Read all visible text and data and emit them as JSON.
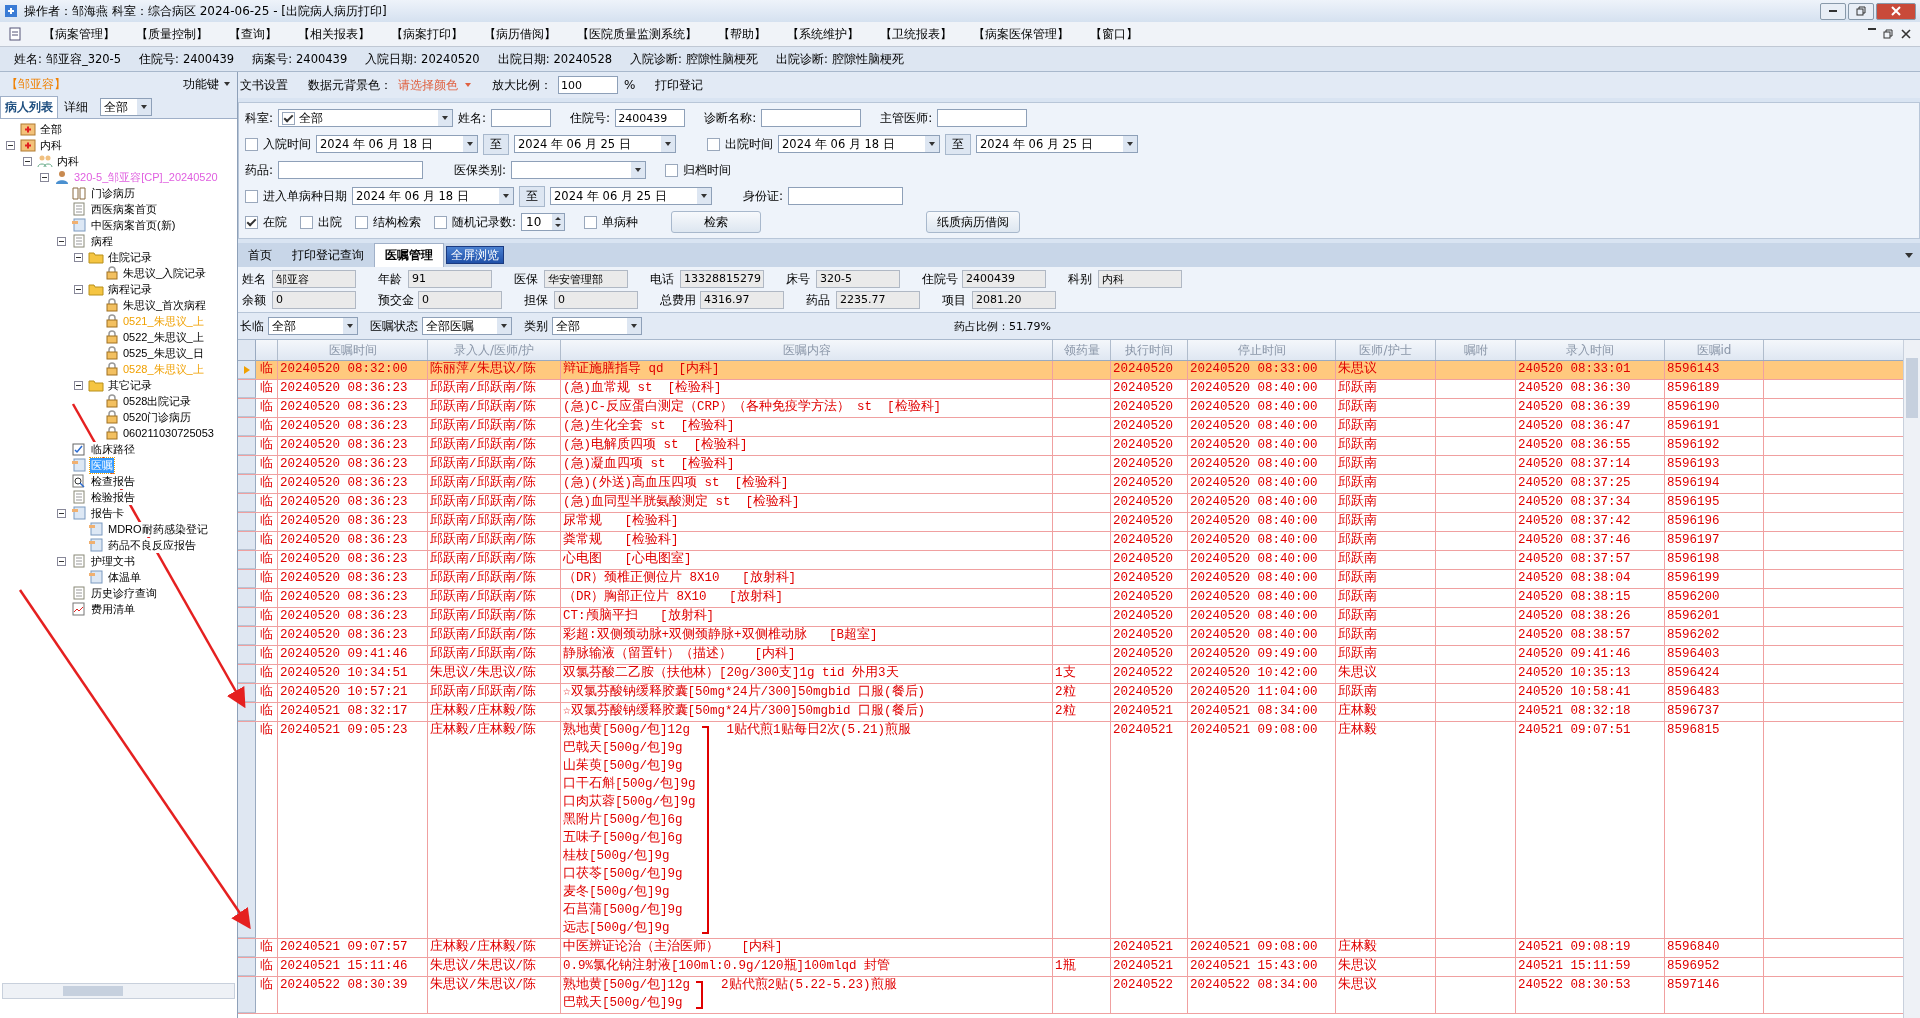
{
  "window": {
    "title": "操作者：邹海燕  科室：综合病区  2024-06-25 - [出院病人病历打印]"
  },
  "menu": [
    "【病案管理】",
    "【质量控制】",
    "【查询】",
    "【相关报表】",
    "【病案打印】",
    "【病历借阅】",
    "【医院质量监测系统】",
    "【帮助】",
    "【系统维护】",
    "【卫统报表】",
    "【病案医保管理】",
    "【窗口】"
  ],
  "patient_bar": [
    {
      "label": "姓名:",
      "value": "邹亚容_320-5"
    },
    {
      "label": "住院号:",
      "value": "2400439"
    },
    {
      "label": "病案号:",
      "value": "2400439"
    },
    {
      "label": "入院日期:",
      "value": "20240520"
    },
    {
      "label": "出院日期:",
      "value": "20240528"
    },
    {
      "label": "入院诊断:",
      "value": "腔隙性脑梗死"
    },
    {
      "label": "出院诊断:",
      "value": "腔隙性脑梗死"
    }
  ],
  "sidebar": {
    "user": "【邹亚容】",
    "function_key": "功能键",
    "tabs": [
      {
        "label": "病人列表",
        "selected": true
      },
      {
        "label": "详细",
        "selected": false
      }
    ],
    "filter": "全部",
    "tree": [
      {
        "label": "全部",
        "kind": "dept",
        "selected": false
      },
      {
        "label": "内科",
        "kind": "dept",
        "selected": false,
        "expanded": true,
        "children": [
          {
            "label": "内科",
            "kind": "group",
            "selected": false,
            "expanded": true,
            "children": [
              {
                "label": "320-5_邹亚容[CP]_20240520",
                "kind": "patient",
                "color": "#e060e0",
                "selected": false,
                "expanded": true,
                "children": [
                  {
                    "label": "门诊病历",
                    "kind": "book",
                    "selected": false
                  },
                  {
                    "label": "西医病案首页",
                    "kind": "doc",
                    "selected": false
                  },
                  {
                    "label": "中医病案首页(新)",
                    "kind": "page",
                    "selected": false
                  },
                  {
                    "label": "病程",
                    "kind": "doc",
                    "selected": false,
                    "expanded": true,
                    "children": [
                      {
                        "label": "住院记录",
                        "kind": "folder",
                        "selected": false,
                        "expanded": true,
                        "children": [
                          {
                            "label": "朱思议_入院记录",
                            "kind": "lock",
                            "selected": false
                          }
                        ]
                      },
                      {
                        "label": "病程记录",
                        "kind": "folder",
                        "selected": false,
                        "expanded": true,
                        "children": [
                          {
                            "label": "朱思议_首次病程",
                            "kind": "lock",
                            "selected": false
                          },
                          {
                            "label": "0521_朱思议_上",
                            "kind": "lock",
                            "color": "#f0a000",
                            "selected": false
                          },
                          {
                            "label": "0522_朱思议_上",
                            "kind": "lock",
                            "selected": false
                          },
                          {
                            "label": "0525_朱思议_日",
                            "kind": "lock",
                            "selected": false
                          },
                          {
                            "label": "0528_朱思议_上",
                            "kind": "lock",
                            "color": "#f0a000",
                            "selected": false
                          }
                        ]
                      },
                      {
                        "label": "其它记录",
                        "kind": "folder",
                        "selected": false,
                        "expanded": true,
                        "children": [
                          {
                            "label": "0528出院记录",
                            "kind": "lock",
                            "selected": false
                          },
                          {
                            "label": "0520门诊病历",
                            "kind": "lock",
                            "selected": false
                          },
                          {
                            "label": "060211030725053",
                            "kind": "lock",
                            "selected": false
                          }
                        ]
                      }
                    ]
                  },
                  {
                    "label": "临床路径",
                    "kind": "check",
                    "selected": false
                  },
                  {
                    "label": "医嘱",
                    "kind": "page",
                    "selected": true
                  },
                  {
                    "label": "检查报告",
                    "kind": "search",
                    "selected": false
                  },
                  {
                    "label": "检验报告",
                    "kind": "doc",
                    "selected": false
                  },
                  {
                    "label": "报告卡",
                    "kind": "page",
                    "selected": false,
                    "expanded": true,
                    "children": [
                      {
                        "label": "MDRO耐药感染登记",
                        "kind": "page",
                        "selected": false
                      },
                      {
                        "label": "药品不良反应报告",
                        "kind": "page",
                        "selected": false
                      }
                    ]
                  },
                  {
                    "label": "护理文书",
                    "kind": "doc",
                    "selected": false,
                    "expanded": true,
                    "children": [
                      {
                        "label": "体温单",
                        "kind": "page",
                        "selected": false
                      }
                    ]
                  },
                  {
                    "label": "历史诊疗查询",
                    "kind": "doc",
                    "selected": false
                  },
                  {
                    "label": "费用清单",
                    "kind": "chart",
                    "selected": false
                  }
                ]
              }
            ]
          }
        ]
      }
    ]
  },
  "toolbar": {
    "doc_settings": "文书设置",
    "bg_label": "数据元背景色：",
    "bg_value": "请选择颜色",
    "zoom_label": "放大比例：",
    "zoom_value": "100",
    "zoom_unit": "%",
    "print_log": "打印登记"
  },
  "search": {
    "dept_label": "科室:",
    "dept_checked": true,
    "dept_value": "全部",
    "name_label": "姓名:",
    "inpatient_label": "住院号:",
    "inpatient_value": "2400439",
    "diag_label": "诊断名称:",
    "doctor_label": "主管医师:",
    "admit": {
      "label": "入院时间",
      "checked": false,
      "to_label": "至",
      "from": "2024 年 06 月 18 日",
      "to": "2024 年 06 月 25 日"
    },
    "discharge": {
      "label": "出院时间",
      "checked": false,
      "to_label": "至",
      "from": "2024 年 06 月 18 日",
      "to": "2024 年 06 月 25 日"
    },
    "drug_label": "药品:",
    "insurance_label": "医保类别:",
    "archive": {
      "label": "归档时间",
      "checked": false
    },
    "disease_date": {
      "label": "进入单病种日期",
      "checked": false,
      "to_label": "至",
      "from": "2024 年 06 月 18 日",
      "to": "2024 年 06 月 25 日"
    },
    "id_label": "身份证:",
    "options": [
      {
        "label": "在院",
        "checked": true
      },
      {
        "label": "出院",
        "checked": false
      },
      {
        "label": "结构检索",
        "checked": false
      }
    ],
    "random": {
      "label": "随机记录数:",
      "checked": false,
      "value": "10"
    },
    "single_disease": {
      "label": "单病种",
      "checked": false
    },
    "search_button": "检索",
    "borrow_button": "纸质病历借阅"
  },
  "tabs": [
    {
      "label": "首页",
      "selected": false
    },
    {
      "label": "打印登记查询",
      "selected": false
    },
    {
      "label": "医嘱管理",
      "selected": true
    }
  ],
  "fullscreen_button": "全屏浏览",
  "info": [
    [
      {
        "label": "姓名",
        "value": "邹亚容"
      },
      {
        "label": "年龄",
        "value": "91"
      },
      {
        "label": "医保",
        "value": "华安管理部"
      },
      {
        "label": "电话",
        "value": "13328815279"
      },
      {
        "label": "床号",
        "value": "320-5"
      },
      {
        "label": "住院号",
        "value": "2400439"
      },
      {
        "label": "科别",
        "value": "内科"
      }
    ],
    [
      {
        "label": "余额",
        "value": "0"
      },
      {
        "label": "预交金",
        "value": "0"
      },
      {
        "label": "担保",
        "value": "0"
      },
      {
        "label": "总费用",
        "value": "4316.97"
      },
      {
        "label": "药品",
        "value": "2235.77"
      },
      {
        "label": "项目",
        "value": "2081.20"
      }
    ]
  ],
  "order_filter": [
    {
      "label": "长临",
      "value": "全部"
    },
    {
      "label": "医嘱状态",
      "value": "全部医嘱"
    },
    {
      "label": "类别",
      "value": "全部"
    }
  ],
  "drug_ratio": "药占比例：51.79%",
  "table": {
    "columns": [
      "医嘱时间",
      "录入人/医师/护",
      "医嘱内容",
      "领药量",
      "执行时间",
      "停止时间",
      "医师/护士",
      "嘱咐",
      "录入时间",
      "医嘱id"
    ],
    "rows": [
      {
        "kind": "single",
        "selected": true,
        "type": "临",
        "time": "20240520 08:32:00",
        "staff": "陈丽萍/朱思议/陈",
        "content": "辩证施膳指导 qd  [内科]",
        "exec": "20240520",
        "stop": "20240520 08:33:00",
        "doctor": "朱思议",
        "entered": "240520 08:33:01",
        "id": "8596143"
      },
      {
        "kind": "single",
        "selected": false,
        "type": "临",
        "time": "20240520 08:36:23",
        "staff": "邱跃南/邱跃南/陈",
        "content": "(急)血常规 st  [检验科]",
        "exec": "20240520",
        "stop": "20240520 08:40:00",
        "doctor": "邱跃南",
        "entered": "240520 08:36:30",
        "id": "8596189"
      },
      {
        "kind": "single",
        "selected": false,
        "type": "临",
        "time": "20240520 08:36:23",
        "staff": "邱跃南/邱跃南/陈",
        "content": "(急)C-反应蛋白测定（CRP）（各种免疫学方法） st  [检验科]",
        "exec": "20240520",
        "stop": "20240520 08:40:00",
        "doctor": "邱跃南",
        "entered": "240520 08:36:39",
        "id": "8596190"
      },
      {
        "kind": "single",
        "selected": false,
        "type": "临",
        "time": "20240520 08:36:23",
        "staff": "邱跃南/邱跃南/陈",
        "content": "(急)生化全套 st  [检验科]",
        "exec": "20240520",
        "stop": "20240520 08:40:00",
        "doctor": "邱跃南",
        "entered": "240520 08:36:47",
        "id": "8596191"
      },
      {
        "kind": "single",
        "selected": false,
        "type": "临",
        "time": "20240520 08:36:23",
        "staff": "邱跃南/邱跃南/陈",
        "content": "(急)电解质四项 st  [检验科]",
        "exec": "20240520",
        "stop": "20240520 08:40:00",
        "doctor": "邱跃南",
        "entered": "240520 08:36:55",
        "id": "8596192"
      },
      {
        "kind": "single",
        "selected": false,
        "type": "临",
        "time": "20240520 08:36:23",
        "staff": "邱跃南/邱跃南/陈",
        "content": "(急)凝血四项 st  [检验科]",
        "exec": "20240520",
        "stop": "20240520 08:40:00",
        "doctor": "邱跃南",
        "entered": "240520 08:37:14",
        "id": "8596193"
      },
      {
        "kind": "single",
        "selected": false,
        "type": "临",
        "time": "20240520 08:36:23",
        "staff": "邱跃南/邱跃南/陈",
        "content": "(急)(外送)高血压四项 st  [检验科]",
        "exec": "20240520",
        "stop": "20240520 08:40:00",
        "doctor": "邱跃南",
        "entered": "240520 08:37:25",
        "id": "8596194"
      },
      {
        "kind": "single",
        "selected": false,
        "type": "临",
        "time": "20240520 08:36:23",
        "staff": "邱跃南/邱跃南/陈",
        "content": "(急)血同型半胱氨酸测定 st  [检验科]",
        "exec": "20240520",
        "stop": "20240520 08:40:00",
        "doctor": "邱跃南",
        "entered": "240520 08:37:34",
        "id": "8596195"
      },
      {
        "kind": "single",
        "selected": false,
        "type": "临",
        "time": "20240520 08:36:23",
        "staff": "邱跃南/邱跃南/陈",
        "content": "尿常规   [检验科]",
        "exec": "20240520",
        "stop": "20240520 08:40:00",
        "doctor": "邱跃南",
        "entered": "240520 08:37:42",
        "id": "8596196"
      },
      {
        "kind": "single",
        "selected": false,
        "type": "临",
        "time": "20240520 08:36:23",
        "staff": "邱跃南/邱跃南/陈",
        "content": "粪常规   [检验科]",
        "exec": "20240520",
        "stop": "20240520 08:40:00",
        "doctor": "邱跃南",
        "entered": "240520 08:37:46",
        "id": "8596197"
      },
      {
        "kind": "single",
        "selected": false,
        "type": "临",
        "time": "20240520 08:36:23",
        "staff": "邱跃南/邱跃南/陈",
        "content": "心电图   [心电图室]",
        "exec": "20240520",
        "stop": "20240520 08:40:00",
        "doctor": "邱跃南",
        "entered": "240520 08:37:57",
        "id": "8596198"
      },
      {
        "kind": "single",
        "selected": false,
        "type": "临",
        "time": "20240520 08:36:23",
        "staff": "邱跃南/邱跃南/陈",
        "content": "（DR）颈椎正侧位片 8X10   [放射科]",
        "exec": "20240520",
        "stop": "20240520 08:40:00",
        "doctor": "邱跃南",
        "entered": "240520 08:38:04",
        "id": "8596199"
      },
      {
        "kind": "single",
        "selected": false,
        "type": "临",
        "time": "20240520 08:36:23",
        "staff": "邱跃南/邱跃南/陈",
        "content": "（DR）胸部正位片 8X10   [放射科]",
        "exec": "20240520",
        "stop": "20240520 08:40:00",
        "doctor": "邱跃南",
        "entered": "240520 08:38:15",
        "id": "8596200"
      },
      {
        "kind": "single",
        "selected": false,
        "type": "临",
        "time": "20240520 08:36:23",
        "staff": "邱跃南/邱跃南/陈",
        "content": "CT:颅脑平扫   [放射科]",
        "exec": "20240520",
        "stop": "20240520 08:40:00",
        "doctor": "邱跃南",
        "entered": "240520 08:38:26",
        "id": "8596201"
      },
      {
        "kind": "single",
        "selected": false,
        "type": "临",
        "time": "20240520 08:36:23",
        "staff": "邱跃南/邱跃南/陈",
        "content": "彩超:双侧颈动脉+双侧颈静脉+双侧椎动脉   [B超室]",
        "exec": "20240520",
        "stop": "20240520 08:40:00",
        "doctor": "邱跃南",
        "entered": "240520 08:38:57",
        "id": "8596202"
      },
      {
        "kind": "single",
        "selected": false,
        "type": "临",
        "time": "20240520 09:41:46",
        "staff": "邱跃南/邱跃南/陈",
        "content": "静脉输液（留置针）（描述）   [内科]",
        "exec": "20240520",
        "stop": "20240520 09:49:00",
        "doctor": "邱跃南",
        "entered": "240520 09:41:46",
        "id": "8596403"
      },
      {
        "kind": "single",
        "selected": false,
        "type": "临",
        "time": "20240520 10:34:51",
        "staff": "朱思议/朱思议/陈",
        "content": "双氯芬酸二乙胺（扶他林）[20g/300支]1g tid 外用3天",
        "qty": "1支",
        "exec": "20240522",
        "stop": "20240520 10:42:00",
        "doctor": "朱思议",
        "entered": "240520 10:35:13",
        "id": "8596424"
      },
      {
        "kind": "single",
        "selected": false,
        "type": "临",
        "time": "20240520 10:57:21",
        "staff": "邱跃南/邱跃南/陈",
        "content": "☆双氯芬酸钠缓释胶囊[50mg*24片/300]50mgbid 口服(餐后)",
        "qty": "2粒",
        "exec": "20240520",
        "stop": "20240520 11:04:00",
        "doctor": "邱跃南",
        "entered": "240520 10:58:41",
        "id": "8596483"
      },
      {
        "kind": "single",
        "selected": false,
        "type": "临",
        "time": "20240521 08:32:17",
        "staff": "庄林毅/庄林毅/陈",
        "content": "☆双氯芬酸钠缓释胶囊[50mg*24片/300]50mgbid 口服(餐后)",
        "qty": "2粒",
        "exec": "20240521",
        "stop": "20240521 08:34:00",
        "doctor": "庄林毅",
        "entered": "240521 08:32:18",
        "id": "8596737"
      },
      {
        "kind": "herbal",
        "selected": false,
        "type": "临",
        "time": "20240521 09:05:23",
        "staff": "庄林毅/庄林毅/陈",
        "herbs": [
          "熟地黄[500g/包]12g",
          "巴戟天[500g/包]9g",
          "山茱萸[500g/包]9g",
          "口干石斛[500g/包]9g",
          "口肉苁蓉[500g/包]9g",
          "黑附片[500g/包]6g",
          "五味子[500g/包]6g",
          "桂枝[500g/包]9g",
          "口茯苓[500g/包]9g",
          "麦冬[500g/包]9g",
          "石菖蒲[500g/包]9g",
          "远志[500g/包]9g"
        ],
        "note": "1贴代煎1贴每日2次(5.21)煎服",
        "exec": "20240521",
        "stop": "20240521 09:08:00",
        "doctor": "庄林毅",
        "entered": "240521 09:07:51",
        "id": "8596815"
      },
      {
        "kind": "single",
        "selected": false,
        "type": "临",
        "time": "20240521 09:07:57",
        "staff": "庄林毅/庄林毅/陈",
        "content": "中医辨证论治（主治医师）   [内科]",
        "exec": "20240521",
        "stop": "20240521 09:08:00",
        "doctor": "庄林毅",
        "entered": "240521 09:08:19",
        "id": "8596840"
      },
      {
        "kind": "single",
        "selected": false,
        "type": "临",
        "time": "20240521 15:11:46",
        "staff": "朱思议/朱思议/陈",
        "content": "0.9%氯化钠注射液[100ml:0.9g/120瓶]100mlqd 封管",
        "qty": "1瓶",
        "exec": "20240521",
        "stop": "20240521 15:43:00",
        "doctor": "朱思议",
        "entered": "240521 15:11:59",
        "id": "8596952"
      },
      {
        "kind": "herbal",
        "selected": false,
        "type": "临",
        "time": "20240522 08:30:39",
        "staff": "朱思议/朱思议/陈",
        "herbs": [
          "熟地黄[500g/包]12g",
          "巴戟天[500g/包]9g"
        ],
        "note": "2贴代煎2贴(5.22-5.23)煎服",
        "exec": "20240522",
        "stop": "20240522 08:34:00",
        "doctor": "朱思议",
        "entered": "240522 08:30:53",
        "id": "8597146"
      }
    ]
  }
}
